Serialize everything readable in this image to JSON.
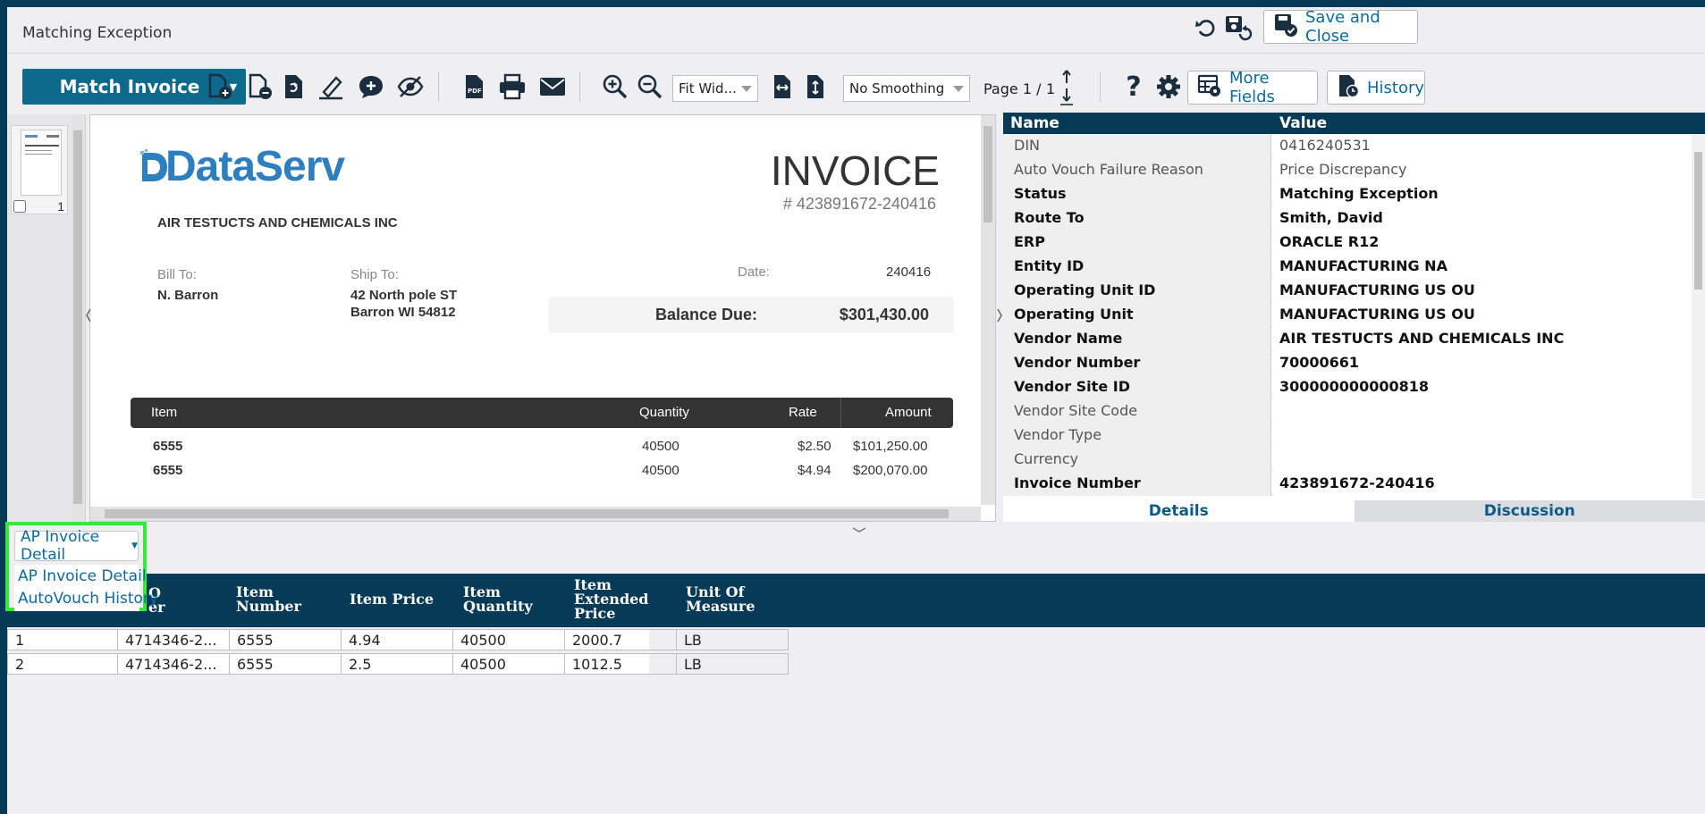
{
  "window": {
    "title": "Matching Exception"
  },
  "header_actions": {
    "save_close_label": "Save and Close"
  },
  "toolbar": {
    "match_label": "Match Invoice",
    "fit_select": "Fit Wid...",
    "smoothing_select": "No Smoothing",
    "page_label": "Page 1 /",
    "page_total": "1",
    "more_fields_label": "More Fields",
    "history_label": "History"
  },
  "thumbs": {
    "page_num": "1"
  },
  "invoice": {
    "logo": "DataServ",
    "company": "AIR TESTUCTS AND CHEMICALS INC",
    "title": "INVOICE",
    "number": "# 423891672-240416",
    "bill_to_label": "Bill To:",
    "bill_to": "N. Barron",
    "ship_to_label": "Ship To:",
    "ship_to_line1": "42 North pole ST",
    "ship_to_line2": "Barron WI 54812",
    "date_label": "Date:",
    "date": "240416",
    "balance_label": "Balance Due:",
    "balance": "$301,430.00",
    "table_headers": [
      "Item",
      "Quantity",
      "Rate",
      "Amount"
    ],
    "lines": [
      {
        "item": "6555",
        "qty": "40500",
        "rate": "$2.50",
        "amount": "$101,250.00"
      },
      {
        "item": "6555",
        "qty": "40500",
        "rate": "$4.94",
        "amount": "$200,070.00"
      }
    ]
  },
  "details": {
    "headers": {
      "name": "Name",
      "value": "Value"
    },
    "rows": [
      {
        "name": "DIN",
        "value": "0416240531"
      },
      {
        "name": "Auto Vouch Failure Reason",
        "value": "Price Discrepancy"
      },
      {
        "name": "Status",
        "value": "Matching Exception"
      },
      {
        "name": "Route To",
        "value": "Smith, David"
      },
      {
        "name": "ERP",
        "value": "ORACLE R12"
      },
      {
        "name": "Entity ID",
        "value": "MANUFACTURING NA"
      },
      {
        "name": "Operating Unit ID",
        "value": "MANUFACTURING US OU"
      },
      {
        "name": "Operating Unit",
        "value": "MANUFACTURING US OU"
      },
      {
        "name": "Vendor Name",
        "value": "AIR TESTUCTS AND CHEMICALS INC"
      },
      {
        "name": "Vendor Number",
        "value": "70000661"
      },
      {
        "name": "Vendor Site ID",
        "value": "300000000000818"
      },
      {
        "name": "Vendor Site Code",
        "value": ""
      },
      {
        "name": "Vendor Type",
        "value": ""
      },
      {
        "name": "Currency",
        "value": ""
      },
      {
        "name": "Invoice Number",
        "value": "423891672-240416"
      }
    ],
    "tabs": {
      "details": "Details",
      "discussion": "Discussion"
    }
  },
  "lower": {
    "dropdown": {
      "selected": "AP Invoice Detail",
      "options": [
        "AP Invoice Detail",
        "AutoVouch History"
      ]
    },
    "columns": {
      "po_number_a": "O",
      "po_number_b": "er",
      "item_number_a": "Item",
      "item_number_b": "Number",
      "item_price": "Item Price",
      "item_quantity_a": "Item",
      "item_quantity_b": "Quantity",
      "item_ext_a": "Item",
      "item_ext_b": "Extended",
      "item_ext_c": "Price",
      "uom_a": "Unit Of",
      "uom_b": "Measure"
    },
    "rows": [
      {
        "line": "1",
        "po": "4714346-2...",
        "item": "6555",
        "price": "4.94",
        "qty": "40500",
        "ext": "2000.7",
        "uom": "LB"
      },
      {
        "line": "2",
        "po": "4714346-2...",
        "item": "6555",
        "price": "2.5",
        "qty": "40500",
        "ext": "1012.5",
        "uom": "LB"
      }
    ]
  },
  "colors": {
    "navy": "#063a56",
    "accent": "#0e6a8d",
    "highlight": "#39e83a",
    "link": "#0b6aa0"
  }
}
